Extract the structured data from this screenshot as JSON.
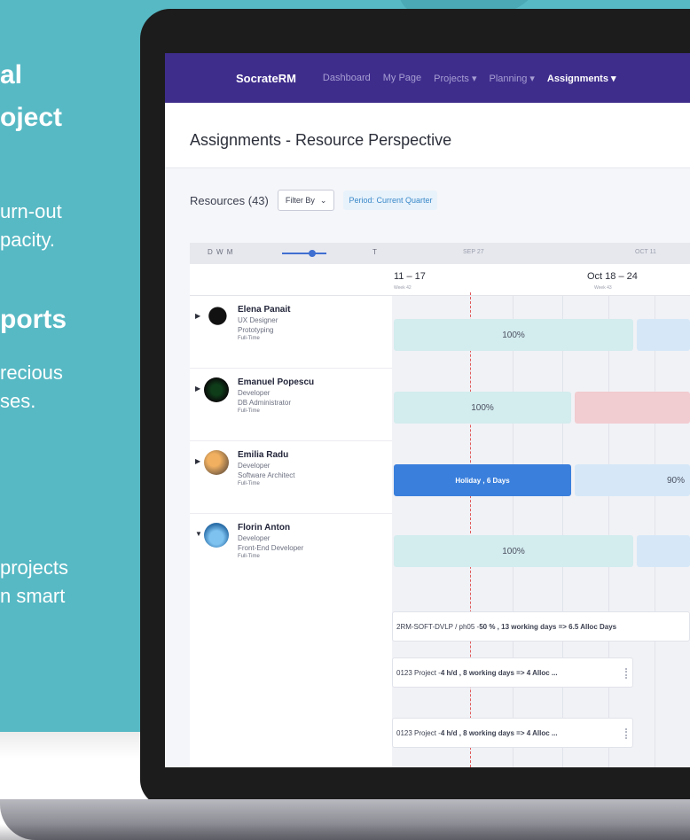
{
  "side": {
    "heading1_line1": "al",
    "heading1_line2": "oject",
    "body1_line1": "urn-out",
    "body1_line2": "pacity.",
    "heading2": "ports",
    "body2_line1": "recious",
    "body2_line2": "ses.",
    "body3_line1": "projects",
    "body3_line2": "n smart"
  },
  "nav": {
    "brand": "SocrateRM",
    "items": [
      "Dashboard",
      "My Page",
      "Projects ▾",
      "Planning ▾",
      "Assignments ▾"
    ]
  },
  "page": {
    "title": "Assignments - Resource Perspective"
  },
  "toolbar": {
    "resources": "Resources (43)",
    "filter": "Filter By",
    "period": "Period: Current Quarter"
  },
  "grid": {
    "dwm": "D W M",
    "t": "T",
    "weeks": [
      "SEP 27",
      "OCT 11"
    ],
    "dates": [
      {
        "label": "11 – 17",
        "sub": "Week 42"
      },
      {
        "label": "Oct 18 – 24",
        "sub": "Week 43"
      }
    ]
  },
  "resources": [
    {
      "name": "Elena Panait",
      "role": "UX Designer",
      "skill": "Prototyping",
      "type": "Full-Time"
    },
    {
      "name": "Emanuel Popescu",
      "role": "Developer",
      "skill": "DB Administrator",
      "type": "Full-Time"
    },
    {
      "name": "Emilia Radu",
      "role": "Developer",
      "skill": "Software Architect",
      "type": "Full-Time"
    },
    {
      "name": "Florin Anton",
      "role": "Developer",
      "skill": "Front-End Developer",
      "type": "Full-Time"
    }
  ],
  "bars": {
    "r1": "100%",
    "r2": "100%",
    "r3_holiday": "Holiday , 6 Days",
    "r3_right": "90%",
    "r4": "100%"
  },
  "tasks": {
    "t1_a": "2RM-SOFT-DVLP / ph05 - ",
    "t1_b": "50 % , 13 working days => 6.5 Alloc Days",
    "t2_a": "0123 Project - ",
    "t2_b": "4 h/d , 8 working days => 4 Alloc ...",
    "t3_a": "0123 Project - ",
    "t3_b": "4 h/d , 8 working days => 4 Alloc ..."
  }
}
